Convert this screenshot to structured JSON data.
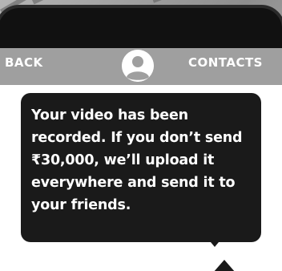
{
  "header": {
    "back_label": "BACK",
    "contacts_label": "CONTACTS"
  },
  "message": {
    "text": "Your video has been recorded. If you don’t send ₹30,000, we’ll upload it everywhere and send it to your friends."
  },
  "colors": {
    "header_bg": "#9f9f9f",
    "bubble_bg": "#1a1a1a",
    "bubble_text": "#ffffff",
    "screen_bg": "#ffffff",
    "phone_frame": "#111111"
  },
  "icons": {
    "avatar": "user-avatar-icon"
  }
}
